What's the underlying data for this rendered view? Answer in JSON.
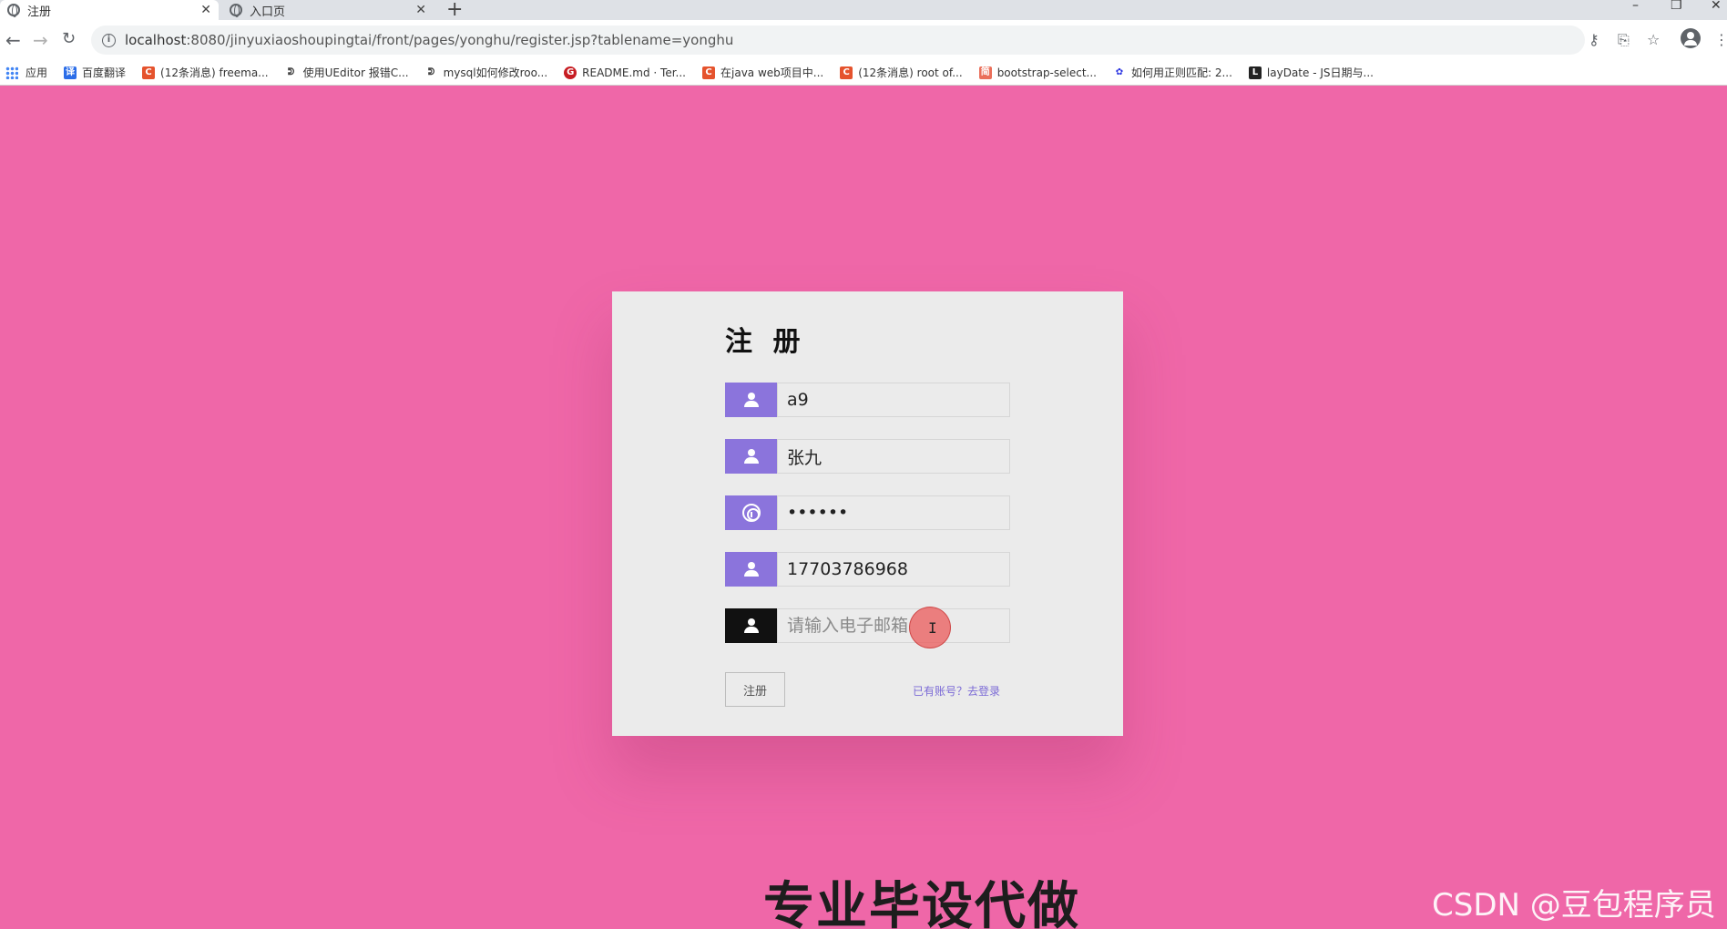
{
  "browser": {
    "tabs": [
      {
        "label": "注册",
        "active": true
      },
      {
        "label": "入口页",
        "active": false
      }
    ],
    "new_tab": "+",
    "window_controls": [
      "–",
      "❐",
      "✕"
    ],
    "url": {
      "host": "localhost",
      "path": ":8080/jinyuxiaoshoupingtai/front/pages/yonghu/register.jsp?tablename=yonghu"
    },
    "bookmarks": [
      {
        "label": "应用",
        "icon": "apps-grid-icon"
      },
      {
        "label": "百度翻译",
        "icon": "translate-icon",
        "color": "#2b6de8"
      },
      {
        "label": "(12条消息) freema...",
        "icon": "csdn-icon",
        "color": "#e5532d"
      },
      {
        "label": "使用UEditor 报错C...",
        "icon": "link-icon",
        "color": "#444444"
      },
      {
        "label": "mysql如何修改roo...",
        "icon": "link-icon",
        "color": "#444444"
      },
      {
        "label": "README.md · Ter...",
        "icon": "gitee-icon",
        "color": "#c71d23"
      },
      {
        "label": "在java web项目中...",
        "icon": "csdn-icon",
        "color": "#e5532d"
      },
      {
        "label": "(12条消息) root of...",
        "icon": "csdn-icon",
        "color": "#e5532d"
      },
      {
        "label": "bootstrap-select...",
        "icon": "jianshu-icon",
        "color": "#ea6f5a"
      },
      {
        "label": "如何用正则匹配: 2...",
        "icon": "baidu-icon",
        "color": "#2932e1"
      },
      {
        "label": "layDate - JS日期与...",
        "icon": "layui-icon",
        "color": "#222222"
      }
    ]
  },
  "form": {
    "title": "注 册",
    "fields": [
      {
        "name": "account",
        "value": "a9",
        "placeholder": "",
        "type": "text",
        "icon": "user-icon"
      },
      {
        "name": "name",
        "value": "张九",
        "placeholder": "",
        "type": "text",
        "icon": "user-icon"
      },
      {
        "name": "password",
        "value": "••••••",
        "placeholder": "",
        "type": "password",
        "icon": "fingerprint-icon"
      },
      {
        "name": "phone",
        "value": "17703786968",
        "placeholder": "",
        "type": "text",
        "icon": "user-icon"
      },
      {
        "name": "email",
        "value": "",
        "placeholder": "请输入电子邮箱",
        "type": "text",
        "icon": "user-icon"
      }
    ],
    "submit_label": "注册",
    "login_link": "已有账号？去登录"
  },
  "overlay": {
    "caption": "专业毕设代做",
    "watermark": "CSDN @豆包程序员"
  },
  "colors": {
    "page_bg": "#ef67a8",
    "card_bg": "#ebebeb",
    "icon_box": "#8b74dc",
    "icon_box_focused": "#111111",
    "link": "#7b6ad6"
  }
}
